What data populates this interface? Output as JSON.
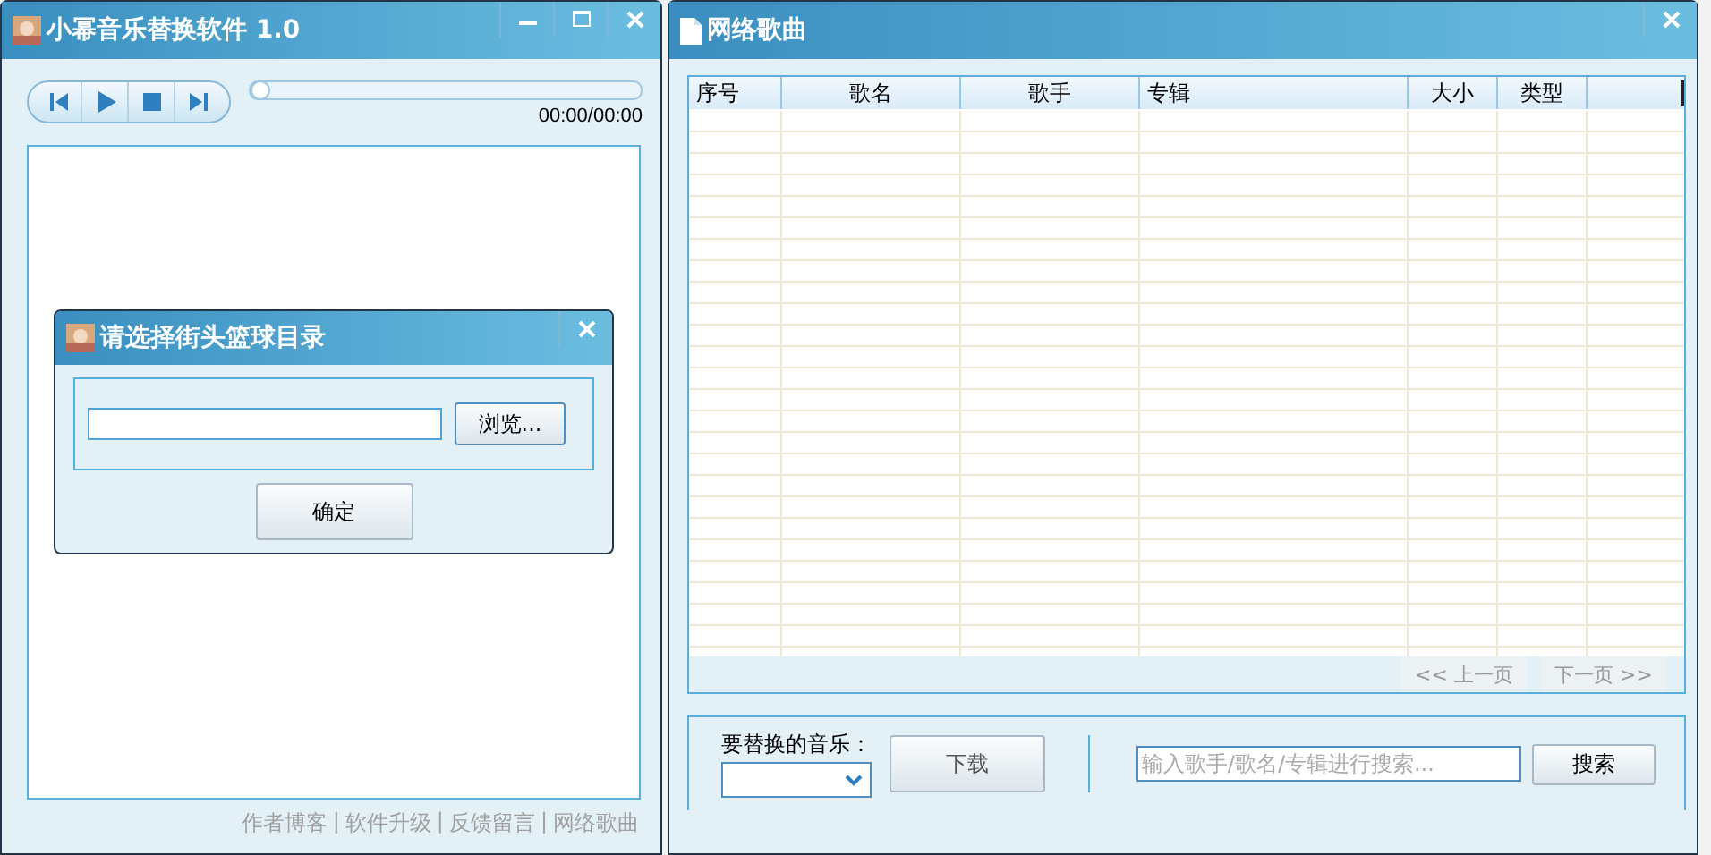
{
  "main_window": {
    "title": "小幂音乐替换软件 1.0",
    "time": "00:00/00:00",
    "progress": {
      "level": 0
    },
    "footer_links": [
      "作者博客",
      "软件升级",
      "反馈留言",
      "网络歌曲"
    ],
    "separator": "|"
  },
  "dialog": {
    "title": "请选择街头篮球目录",
    "browse_button": "浏览...",
    "ok_button": "确定"
  },
  "songs_window": {
    "title": "网络歌曲",
    "table": {
      "columns": [
        "序号",
        "歌名",
        "歌手",
        "专辑",
        "大小",
        "类型"
      ]
    },
    "pager": [
      {
        "label": "<< 上一页",
        "disabled": true
      },
      {
        "label": "下一页 >>",
        "disabled": true
      }
    ],
    "replace_label": "要替换的音乐：",
    "download_button": {
      "label": "下载",
      "disabled": true
    },
    "search": {
      "placeholder": "输入歌手/歌名/专辑进行搜索..."
    },
    "search_button": "搜索"
  }
}
